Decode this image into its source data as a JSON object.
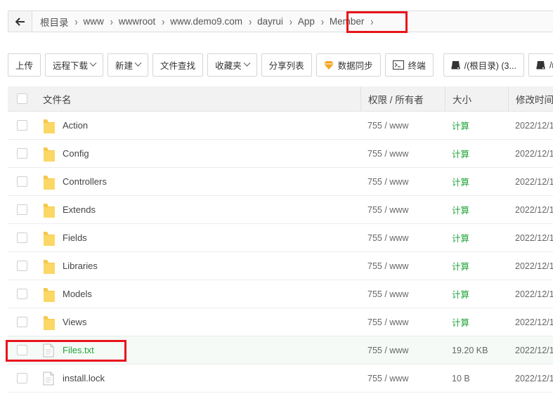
{
  "breadcrumb": {
    "items": [
      "根目录",
      "www",
      "wwwroot",
      "www.demo9.com",
      "dayrui",
      "App",
      "Member"
    ]
  },
  "toolbar": {
    "upload": "上传",
    "remote_download": "远程下载",
    "new": "新建",
    "file_search": "文件查找",
    "favorites": "收藏夹",
    "share_list": "分享列表",
    "data_sync": "数据同步",
    "terminal": "终端",
    "disk_root": "/(根目录) (3...",
    "disk_m": "/m"
  },
  "columns": {
    "name": "文件名",
    "perm": "权限 / 所有者",
    "size": "大小",
    "time": "修改时间"
  },
  "rows": [
    {
      "name": "Action",
      "type": "folder",
      "perm": "755 / www",
      "size": "计算",
      "time": "2022/12/1"
    },
    {
      "name": "Config",
      "type": "folder",
      "perm": "755 / www",
      "size": "计算",
      "time": "2022/12/1"
    },
    {
      "name": "Controllers",
      "type": "folder",
      "perm": "755 / www",
      "size": "计算",
      "time": "2022/12/1"
    },
    {
      "name": "Extends",
      "type": "folder",
      "perm": "755 / www",
      "size": "计算",
      "time": "2022/12/1"
    },
    {
      "name": "Fields",
      "type": "folder",
      "perm": "755 / www",
      "size": "计算",
      "time": "2022/12/1"
    },
    {
      "name": "Libraries",
      "type": "folder",
      "perm": "755 / www",
      "size": "计算",
      "time": "2022/12/1"
    },
    {
      "name": "Models",
      "type": "folder",
      "perm": "755 / www",
      "size": "计算",
      "time": "2022/12/1"
    },
    {
      "name": "Views",
      "type": "folder",
      "perm": "755 / www",
      "size": "计算",
      "time": "2022/12/1"
    },
    {
      "name": "Files.txt",
      "type": "file",
      "perm": "755 / www",
      "size": "19.20 KB",
      "time": "2022/12/1"
    },
    {
      "name": "install.lock",
      "type": "file",
      "perm": "755 / www",
      "size": "10 B",
      "time": "2022/12/1"
    }
  ],
  "colors": {
    "accent_green": "#20a53a",
    "highlight_red": "#e8141c",
    "folder_yellow": "#f5c84c"
  }
}
